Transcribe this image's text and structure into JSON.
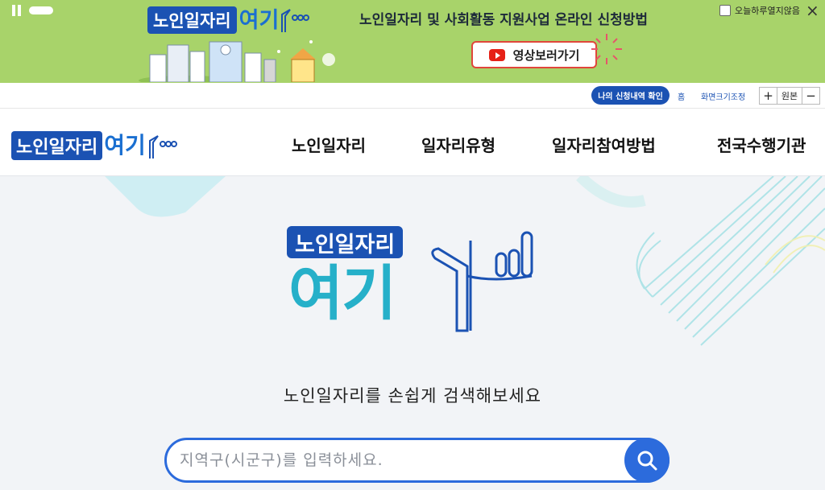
{
  "banner": {
    "logo_box": "노인일자리",
    "logo_yeogi": "여기",
    "title": "노인일자리 및 사회활동 지원사업 온라인 신청방법",
    "video_button": "영상보러가기",
    "today_close": "오늘하루열지않음",
    "close_icon": "×",
    "colors": {
      "background": "#a8d36a",
      "button_border": "#e0463b"
    }
  },
  "util": {
    "my_application": "나의 신청내역 확인",
    "home": "홈",
    "zoom_label": "화면크기조정",
    "zoom_in": "+",
    "zoom_original": "원본",
    "zoom_out": "−"
  },
  "header": {
    "logo_box": "노인일자리",
    "logo_yeogi": "여기",
    "nav": [
      "노인일자리",
      "일자리유형",
      "일자리참여방법",
      "전국수행기관"
    ]
  },
  "hero": {
    "logo_box": "노인일자리",
    "logo_yeogi": "여기",
    "subtitle": "노인일자리를 손쉽게 검색해보세요",
    "search_placeholder": "지역구(시군구)를 입력하세요.",
    "search_value": ""
  },
  "icons": [
    "pause-icon",
    "youtube-play-icon",
    "checkbox-icon",
    "close-icon",
    "search-icon"
  ],
  "colors": {
    "brand_blue": "#1b52b3",
    "brand_teal": "#26b0c9",
    "search_blue": "#2c6bdc"
  }
}
